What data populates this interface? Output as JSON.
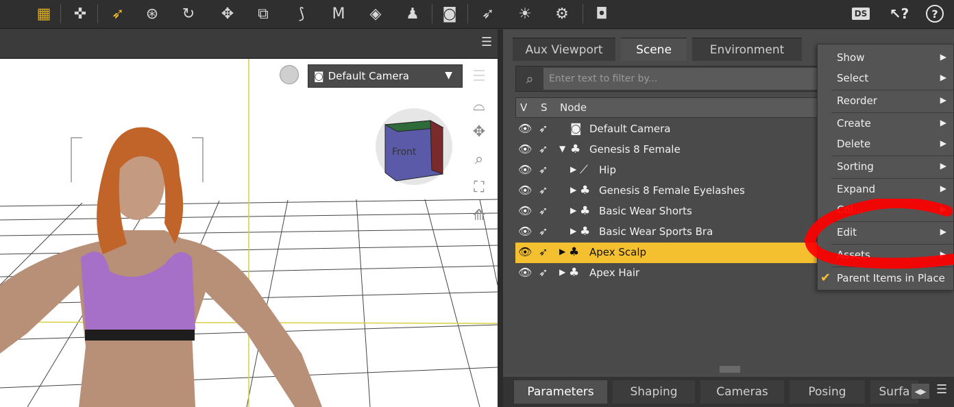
{
  "toolbar": {
    "icons": [
      "grid-icon",
      "universal-tool-icon",
      "node-selection-icon",
      "rotate-view-icon",
      "rotate-icon",
      "translate-icon",
      "scale-icon",
      "joint-editor-icon",
      "geometry-editor-icon",
      "surface-selection-icon",
      "figure-icon",
      "render-icon",
      "region-nav-icon",
      "light-icon",
      "render-settings-icon",
      "camera-icon"
    ],
    "right_icons": [
      "daz-home-icon",
      "whats-this-icon",
      "help-icon"
    ],
    "help_label": "?",
    "whats_this_label": "?"
  },
  "viewport": {
    "camera_label": "Default Camera",
    "cube_label": "Front"
  },
  "tabs": [
    "Aux Viewport",
    "Scene",
    "Environment"
  ],
  "active_tab": "Scene",
  "filter": {
    "placeholder": "Enter text to filter by..."
  },
  "columns": {
    "v": "V",
    "s": "S",
    "node": "Node"
  },
  "tree": [
    {
      "label": "Default Camera",
      "indent": 0,
      "expander": false,
      "icon": "camera-icon",
      "selected": false
    },
    {
      "label": "Genesis 8 Female",
      "indent": 0,
      "expander": true,
      "expanded": true,
      "icon": "figure-icon",
      "selected": false
    },
    {
      "label": "Hip",
      "indent": 1,
      "expander": true,
      "icon": "bone-icon",
      "selected": false
    },
    {
      "label": "Genesis 8 Female Eyelashes",
      "indent": 1,
      "expander": true,
      "icon": "figure-icon",
      "selected": false
    },
    {
      "label": "Basic Wear Shorts",
      "indent": 1,
      "expander": true,
      "icon": "figure-icon",
      "selected": false
    },
    {
      "label": "Basic Wear Sports Bra",
      "indent": 1,
      "expander": true,
      "icon": "figure-icon",
      "selected": false
    },
    {
      "label": "Apex Scalp",
      "indent": 0,
      "expander": true,
      "icon": "figure-icon",
      "selected": true
    },
    {
      "label": "Apex Hair",
      "indent": 0,
      "expander": true,
      "icon": "figure-icon",
      "selected": false
    }
  ],
  "menu": {
    "items": [
      {
        "label": "Show",
        "submenu": true
      },
      {
        "label": "Select",
        "submenu": true
      },
      {
        "label": "Reorder",
        "submenu": true
      },
      {
        "label": "Create",
        "submenu": true
      },
      {
        "label": "Delete",
        "submenu": true
      },
      {
        "label": "Sorting",
        "submenu": true
      },
      {
        "label": "Expand",
        "submenu": true
      },
      {
        "label": "Col...",
        "submenu": true
      },
      {
        "label": "Edit",
        "submenu": true
      },
      {
        "label": "Assets",
        "submenu": true
      },
      {
        "label": "Parent Items in Place",
        "submenu": false,
        "checked": true
      }
    ]
  },
  "bottom_tabs": [
    "Parameters",
    "Shaping",
    "Cameras",
    "Posing",
    "Surfa"
  ],
  "active_bottom_tab": "Parameters",
  "colors": {
    "selection": "#f5c030",
    "annotation": "#ff0000"
  }
}
